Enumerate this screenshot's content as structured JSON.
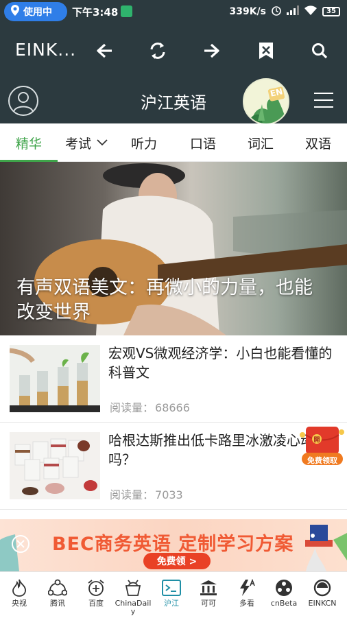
{
  "status_bar": {
    "pill_label": "使用中",
    "time": "下午3:48",
    "network_speed": "339K/s",
    "battery": "35"
  },
  "toolbar": {
    "title": "EINK...",
    "icons": [
      "back-arrow-icon",
      "refresh-icon",
      "forward-arrow-icon",
      "close-tab-icon",
      "search-icon"
    ]
  },
  "app_header": {
    "title": "沪江英语",
    "badge_text": "EN"
  },
  "tabs": [
    {
      "label": "精华",
      "active": true
    },
    {
      "label": "考试",
      "active": false,
      "has_dropdown": true
    },
    {
      "label": "听力",
      "active": false
    },
    {
      "label": "口语",
      "active": false
    },
    {
      "label": "词汇",
      "active": false
    },
    {
      "label": "双语",
      "active": false
    }
  ],
  "hero": {
    "caption": "有声双语美文：再微小的力量，也能改变世界"
  },
  "articles": [
    {
      "title": "宏观VS微观经济学：小白也能看懂的科普文",
      "reads_label": "阅读量：",
      "reads_value": "68666"
    },
    {
      "title": "哈根达斯推出低卡路里冰激凌心动了吗？",
      "reads_label": "阅读量：",
      "reads_value": "7033"
    }
  ],
  "floating_promo": {
    "seal_text": "開",
    "label": "免费领取"
  },
  "ad_banner": {
    "title": "BEC商务英语 定制学习方案",
    "cta": "免费领 >"
  },
  "bottom_nav": [
    {
      "label": "央视",
      "icon": "flame-icon"
    },
    {
      "label": "腾讯",
      "icon": "share-network-icon"
    },
    {
      "label": "百度",
      "icon": "alarm-plus-icon"
    },
    {
      "label": "ChinaDaily",
      "icon": "bucket-icon"
    },
    {
      "label": "沪江",
      "icon": "terminal-icon",
      "active": true
    },
    {
      "label": "可可",
      "icon": "bank-icon"
    },
    {
      "label": "多看",
      "icon": "flash-a-icon"
    },
    {
      "label": "cnBeta",
      "icon": "dots-circle-icon"
    },
    {
      "label": "EINKCN",
      "icon": "ring-icon"
    }
  ],
  "colors": {
    "bar_bg": "#2c3a3f",
    "accent_green": "#3fa44a",
    "active_nav": "#1f8fa6",
    "ad_orange": "#f05a34"
  }
}
